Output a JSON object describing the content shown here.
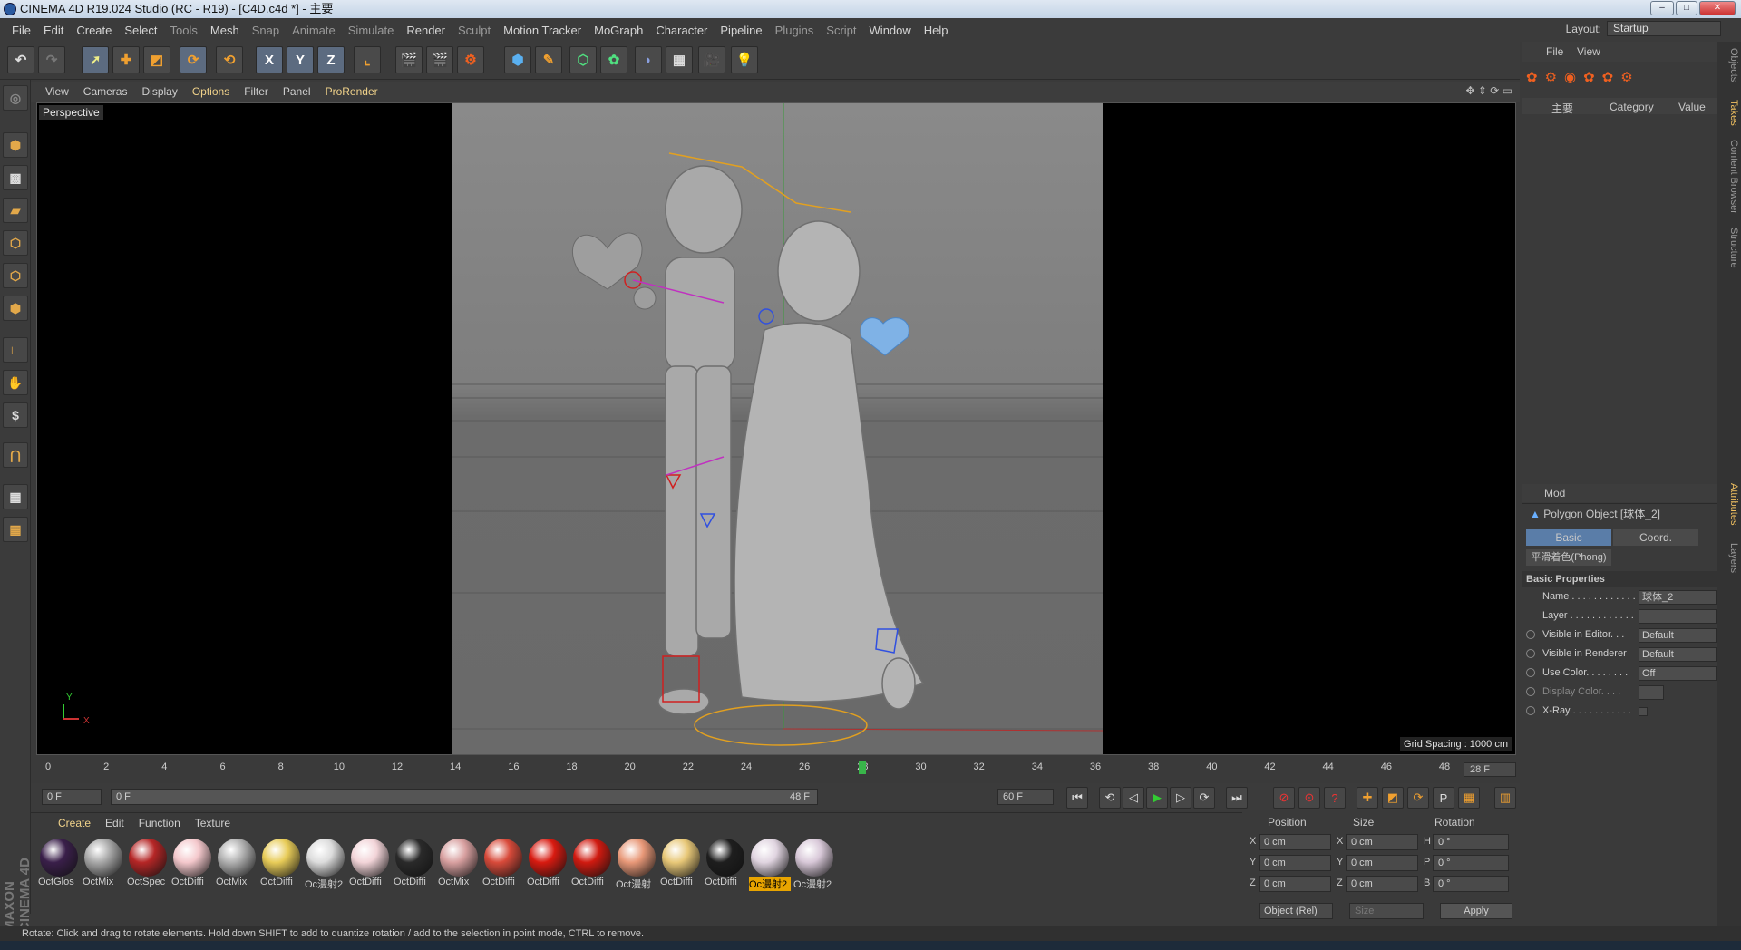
{
  "window": {
    "title": "CINEMA 4D R19.024 Studio (RC - R19) - [C4D.c4d *] - 主要",
    "buttons": [
      "–",
      "□",
      "✕"
    ]
  },
  "menu": {
    "items": [
      "File",
      "Edit",
      "Create",
      "Select",
      "Tools",
      "Mesh",
      "Snap",
      "Animate",
      "Simulate",
      "Render",
      "Sculpt",
      "Motion Tracker",
      "MoGraph",
      "Character",
      "Pipeline",
      "Plugins",
      "Script",
      "Window",
      "Help"
    ],
    "layout_label": "Layout:",
    "layout_value": "Startup"
  },
  "toolbar": {
    "axes": [
      "X",
      "Y",
      "Z"
    ]
  },
  "viewport": {
    "menu": [
      "View",
      "Cameras",
      "Display",
      "Options",
      "Filter",
      "Panel",
      "ProRender"
    ],
    "label": "Perspective",
    "grid_spacing": "Grid Spacing : 1000 cm",
    "axis_y": "Y",
    "axis_x": "X"
  },
  "timeline": {
    "ticks": [
      "0",
      "2",
      "4",
      "6",
      "8",
      "10",
      "12",
      "14",
      "16",
      "18",
      "20",
      "22",
      "24",
      "26",
      "28",
      "30",
      "32",
      "34",
      "36",
      "38",
      "40",
      "42",
      "44",
      "46",
      "48"
    ],
    "current_frame": "28 F",
    "current_frame_number": 28,
    "start": "0 F",
    "range_start": "0 F",
    "range_end": "48 F",
    "end": "60 F"
  },
  "materials": {
    "menu": [
      "Create",
      "Edit",
      "Function",
      "Texture"
    ],
    "items": [
      {
        "label": "OctGlos",
        "color": "#3a1f4a"
      },
      {
        "label": "OctMix",
        "color": "#a8a8a8"
      },
      {
        "label": "OctSpec",
        "color": "#b52626"
      },
      {
        "label": "OctDiffi",
        "color": "#f4c8cc"
      },
      {
        "label": "OctMix",
        "color": "#b0b0b0"
      },
      {
        "label": "OctDiffi",
        "color": "#e8cc58"
      },
      {
        "label": "Oc漫射2",
        "color": "#dcdcdc"
      },
      {
        "label": "OctDiffi",
        "color": "#f2d4d8"
      },
      {
        "label": "OctDiffi",
        "color": "#2a2a2a"
      },
      {
        "label": "OctMix",
        "color": "#d8a0a0"
      },
      {
        "label": "OctDiffi",
        "color": "#d84a3a"
      },
      {
        "label": "OctDiffi",
        "color": "#d81a10"
      },
      {
        "label": "OctDiffi",
        "color": "#d01a10"
      },
      {
        "label": "Oct漫射",
        "color": "#e89878"
      },
      {
        "label": "OctDiffi",
        "color": "#e8c878"
      },
      {
        "label": "OctDiffi",
        "color": "#1e1e1e"
      },
      {
        "label": "Oc漫射2",
        "color": "#e0d4e0"
      },
      {
        "label": "Oc漫射2",
        "color": "#d8c8d8"
      }
    ]
  },
  "coords": {
    "headers": [
      "Position",
      "Size",
      "Rotation"
    ],
    "rows": [
      {
        "a": "X",
        "pos": "0 cm",
        "b": "X",
        "size": "0 cm",
        "c": "H",
        "rot": "0 °"
      },
      {
        "a": "Y",
        "pos": "0 cm",
        "b": "Y",
        "size": "0 cm",
        "c": "P",
        "rot": "0 °"
      },
      {
        "a": "Z",
        "pos": "0 cm",
        "b": "Z",
        "size": "0 cm",
        "c": "B",
        "rot": "0 °"
      }
    ],
    "mode": "Object (Rel)",
    "size_mode": "Size",
    "apply": "Apply"
  },
  "objects": {
    "menu": [
      "File",
      "View"
    ],
    "col_main": "主要",
    "col_category": "Category",
    "col_value": "Value"
  },
  "attributes": {
    "mode": "Mod",
    "object": "Polygon Object [球体_2]",
    "tabs": [
      "Basic",
      "Coord."
    ],
    "phong": "平滑着色(Phong)",
    "section": "Basic Properties",
    "fields": [
      {
        "label": "Name . . . . . . . . . . . .",
        "value": "球体_2"
      },
      {
        "label": "Layer . . . . . . . . . . . .",
        "value": ""
      },
      {
        "label": "Visible in Editor. . .",
        "value": "Default"
      },
      {
        "label": "Visible in Renderer",
        "value": "Default"
      },
      {
        "label": "Use Color. . . . . . . .",
        "value": "Off"
      },
      {
        "label": "Display Color. . . .",
        "value": ""
      },
      {
        "label": "X-Ray . . . . . . . . . . .",
        "value": ""
      }
    ]
  },
  "side_tabs": [
    "Objects",
    "Takes",
    "Content Browser",
    "Structure",
    "Attributes",
    "Layers"
  ],
  "status": "Rotate: Click and drag to rotate elements. Hold down SHIFT to add to quantize rotation / add to the selection in point mode, CTRL to remove.",
  "brand": "MAXON CINEMA 4D"
}
